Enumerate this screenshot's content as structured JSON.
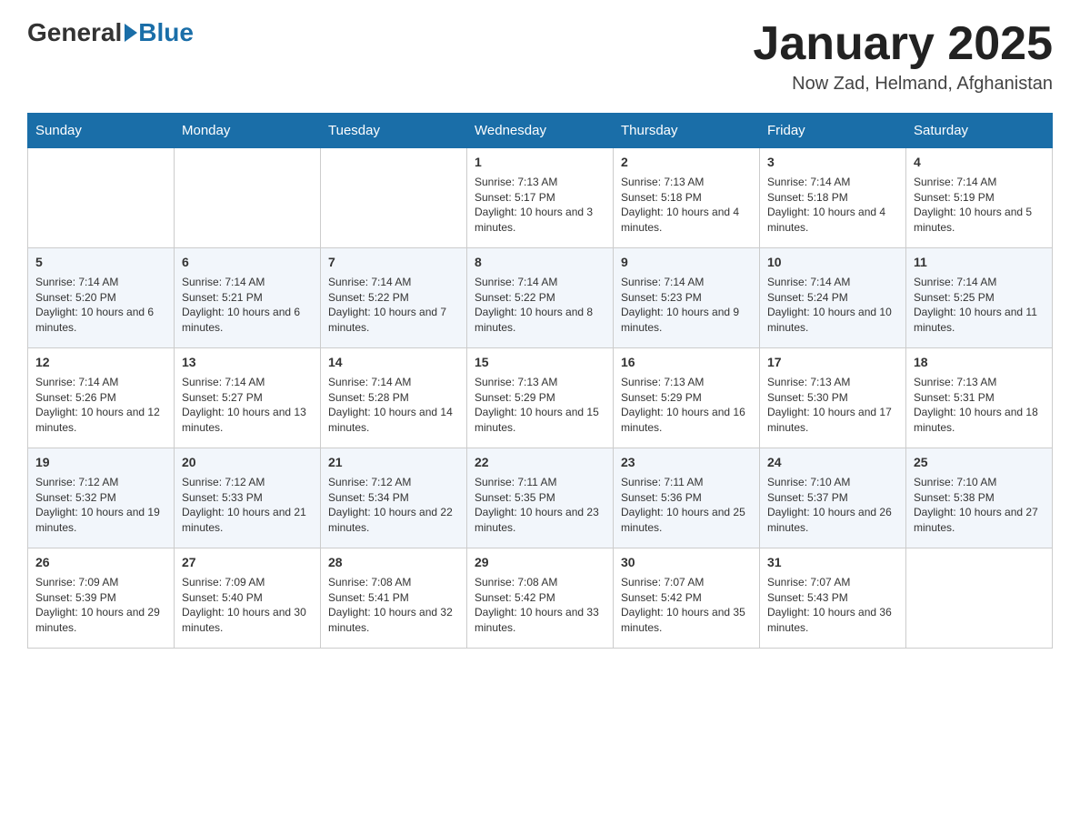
{
  "header": {
    "logo_general": "General",
    "logo_blue": "Blue",
    "month_title": "January 2025",
    "location": "Now Zad, Helmand, Afghanistan"
  },
  "days_of_week": [
    "Sunday",
    "Monday",
    "Tuesday",
    "Wednesday",
    "Thursday",
    "Friday",
    "Saturday"
  ],
  "weeks": [
    [
      {
        "day": "",
        "info": ""
      },
      {
        "day": "",
        "info": ""
      },
      {
        "day": "",
        "info": ""
      },
      {
        "day": "1",
        "info": "Sunrise: 7:13 AM\nSunset: 5:17 PM\nDaylight: 10 hours and 3 minutes."
      },
      {
        "day": "2",
        "info": "Sunrise: 7:13 AM\nSunset: 5:18 PM\nDaylight: 10 hours and 4 minutes."
      },
      {
        "day": "3",
        "info": "Sunrise: 7:14 AM\nSunset: 5:18 PM\nDaylight: 10 hours and 4 minutes."
      },
      {
        "day": "4",
        "info": "Sunrise: 7:14 AM\nSunset: 5:19 PM\nDaylight: 10 hours and 5 minutes."
      }
    ],
    [
      {
        "day": "5",
        "info": "Sunrise: 7:14 AM\nSunset: 5:20 PM\nDaylight: 10 hours and 6 minutes."
      },
      {
        "day": "6",
        "info": "Sunrise: 7:14 AM\nSunset: 5:21 PM\nDaylight: 10 hours and 6 minutes."
      },
      {
        "day": "7",
        "info": "Sunrise: 7:14 AM\nSunset: 5:22 PM\nDaylight: 10 hours and 7 minutes."
      },
      {
        "day": "8",
        "info": "Sunrise: 7:14 AM\nSunset: 5:22 PM\nDaylight: 10 hours and 8 minutes."
      },
      {
        "day": "9",
        "info": "Sunrise: 7:14 AM\nSunset: 5:23 PM\nDaylight: 10 hours and 9 minutes."
      },
      {
        "day": "10",
        "info": "Sunrise: 7:14 AM\nSunset: 5:24 PM\nDaylight: 10 hours and 10 minutes."
      },
      {
        "day": "11",
        "info": "Sunrise: 7:14 AM\nSunset: 5:25 PM\nDaylight: 10 hours and 11 minutes."
      }
    ],
    [
      {
        "day": "12",
        "info": "Sunrise: 7:14 AM\nSunset: 5:26 PM\nDaylight: 10 hours and 12 minutes."
      },
      {
        "day": "13",
        "info": "Sunrise: 7:14 AM\nSunset: 5:27 PM\nDaylight: 10 hours and 13 minutes."
      },
      {
        "day": "14",
        "info": "Sunrise: 7:14 AM\nSunset: 5:28 PM\nDaylight: 10 hours and 14 minutes."
      },
      {
        "day": "15",
        "info": "Sunrise: 7:13 AM\nSunset: 5:29 PM\nDaylight: 10 hours and 15 minutes."
      },
      {
        "day": "16",
        "info": "Sunrise: 7:13 AM\nSunset: 5:29 PM\nDaylight: 10 hours and 16 minutes."
      },
      {
        "day": "17",
        "info": "Sunrise: 7:13 AM\nSunset: 5:30 PM\nDaylight: 10 hours and 17 minutes."
      },
      {
        "day": "18",
        "info": "Sunrise: 7:13 AM\nSunset: 5:31 PM\nDaylight: 10 hours and 18 minutes."
      }
    ],
    [
      {
        "day": "19",
        "info": "Sunrise: 7:12 AM\nSunset: 5:32 PM\nDaylight: 10 hours and 19 minutes."
      },
      {
        "day": "20",
        "info": "Sunrise: 7:12 AM\nSunset: 5:33 PM\nDaylight: 10 hours and 21 minutes."
      },
      {
        "day": "21",
        "info": "Sunrise: 7:12 AM\nSunset: 5:34 PM\nDaylight: 10 hours and 22 minutes."
      },
      {
        "day": "22",
        "info": "Sunrise: 7:11 AM\nSunset: 5:35 PM\nDaylight: 10 hours and 23 minutes."
      },
      {
        "day": "23",
        "info": "Sunrise: 7:11 AM\nSunset: 5:36 PM\nDaylight: 10 hours and 25 minutes."
      },
      {
        "day": "24",
        "info": "Sunrise: 7:10 AM\nSunset: 5:37 PM\nDaylight: 10 hours and 26 minutes."
      },
      {
        "day": "25",
        "info": "Sunrise: 7:10 AM\nSunset: 5:38 PM\nDaylight: 10 hours and 27 minutes."
      }
    ],
    [
      {
        "day": "26",
        "info": "Sunrise: 7:09 AM\nSunset: 5:39 PM\nDaylight: 10 hours and 29 minutes."
      },
      {
        "day": "27",
        "info": "Sunrise: 7:09 AM\nSunset: 5:40 PM\nDaylight: 10 hours and 30 minutes."
      },
      {
        "day": "28",
        "info": "Sunrise: 7:08 AM\nSunset: 5:41 PM\nDaylight: 10 hours and 32 minutes."
      },
      {
        "day": "29",
        "info": "Sunrise: 7:08 AM\nSunset: 5:42 PM\nDaylight: 10 hours and 33 minutes."
      },
      {
        "day": "30",
        "info": "Sunrise: 7:07 AM\nSunset: 5:42 PM\nDaylight: 10 hours and 35 minutes."
      },
      {
        "day": "31",
        "info": "Sunrise: 7:07 AM\nSunset: 5:43 PM\nDaylight: 10 hours and 36 minutes."
      },
      {
        "day": "",
        "info": ""
      }
    ]
  ]
}
